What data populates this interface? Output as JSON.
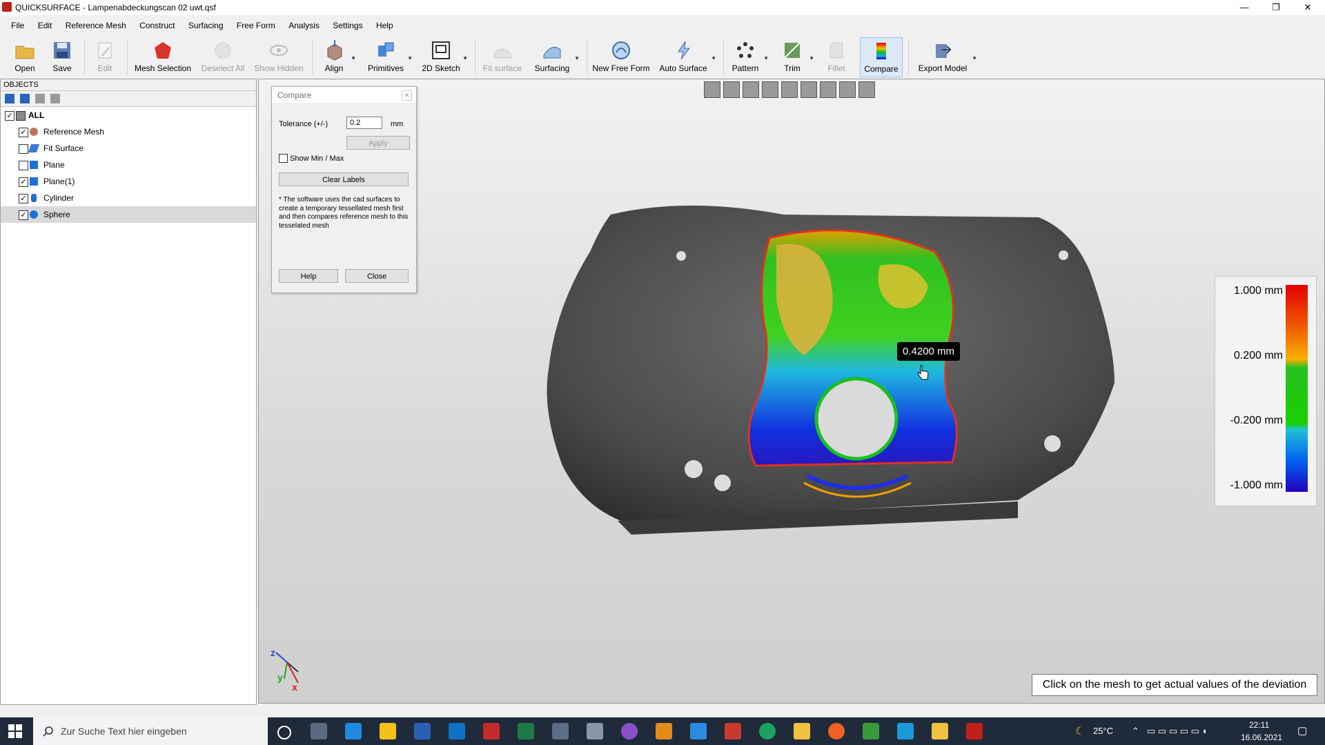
{
  "window": {
    "title": "QUICKSURFACE - Lampenabdeckungscan 02 uwt.qsf",
    "min_glyph": "—",
    "restore_glyph": "❐",
    "close_glyph": "✕"
  },
  "menu": [
    "File",
    "Edit",
    "Reference Mesh",
    "Construct",
    "Surfacing",
    "Free Form",
    "Analysis",
    "Settings",
    "Help"
  ],
  "toolbar": {
    "open": "Open",
    "save": "Save",
    "edit": "Edit",
    "mesh_selection": "Mesh Selection",
    "deselect_all": "Deselect All",
    "show_hidden": "Show Hidden",
    "align": "Align",
    "primitives": "Primitives",
    "sketch_2d": "2D Sketch",
    "fit_surface": "Fit surface",
    "surfacing": "Surfacing",
    "new_free_form": "New Free Form",
    "auto_surface": "Auto Surface",
    "pattern": "Pattern",
    "trim": "Trim",
    "fillet": "Fillet",
    "compare": "Compare",
    "export_model": "Export Model"
  },
  "objects_panel": {
    "header": "OBJECTS",
    "items": [
      {
        "label": "ALL",
        "checked": true
      },
      {
        "label": "Reference Mesh",
        "checked": true
      },
      {
        "label": "Fit Surface",
        "checked": false
      },
      {
        "label": "Plane",
        "checked": false
      },
      {
        "label": "Plane(1)",
        "checked": true
      },
      {
        "label": "Cylinder",
        "checked": true
      },
      {
        "label": "Sphere",
        "checked": true
      }
    ]
  },
  "compare_dialog": {
    "title": "Compare",
    "tolerance_label": "Tolerance (+/-)",
    "tolerance_value": "0.2",
    "unit": "mm",
    "apply": "Apply",
    "show_min_max": "Show Min / Max",
    "show_min_max_checked": false,
    "clear_labels": "Clear Labels",
    "note": "* The software uses the cad surfaces to create a temporary tessellated mesh first and then compares reference mesh to this tesselated mesh",
    "help": "Help",
    "close": "Close"
  },
  "legend": {
    "values": [
      "1.000 mm",
      "0.200 mm",
      "-0.200 mm",
      "-1.000 mm"
    ]
  },
  "tooltip": "0.4200 mm",
  "hint": "Click on the mesh to get actual values of the deviation",
  "axes": {
    "z": "z",
    "y": "y",
    "x": "x"
  },
  "taskbar": {
    "search_placeholder": "Zur Suche Text hier eingeben",
    "temperature": "25°C",
    "time": "22:11",
    "date": "16.06.2021"
  }
}
